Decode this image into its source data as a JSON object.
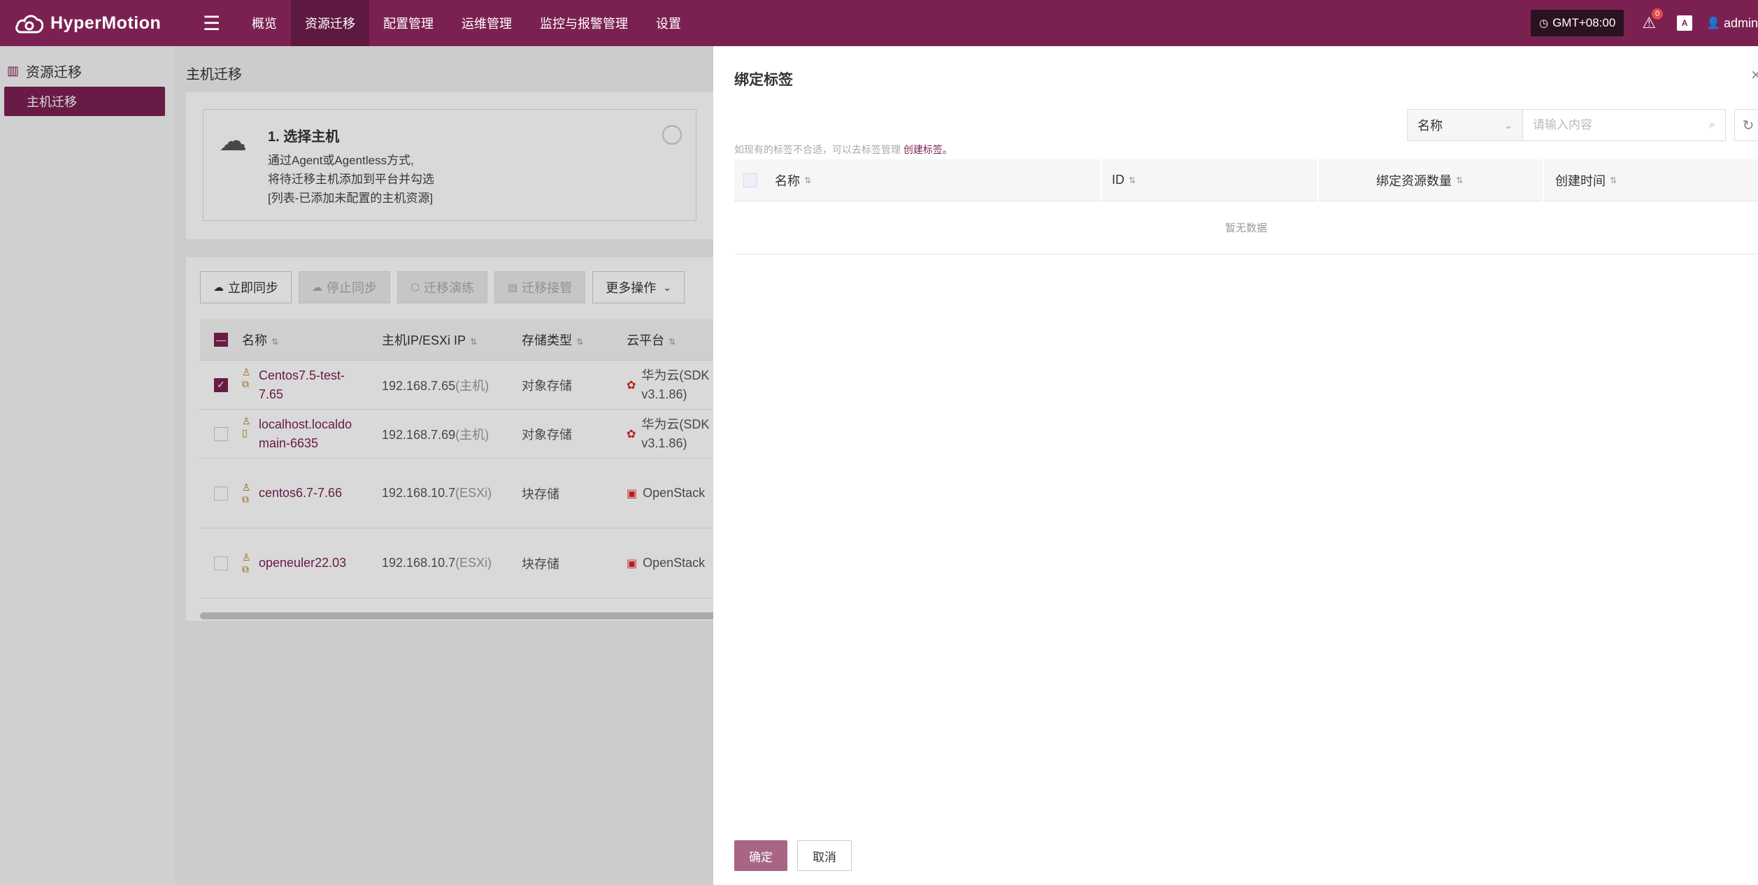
{
  "app": {
    "name": "HyperMotion"
  },
  "nav": {
    "items": [
      "概览",
      "资源迁移",
      "配置管理",
      "运维管理",
      "监控与报警管理",
      "设置"
    ],
    "active_index": 1
  },
  "topright": {
    "timezone": "GMT+08:00",
    "notifications": "0",
    "lang_icon": "A",
    "user": "admin"
  },
  "sidebar": {
    "title": "资源迁移",
    "items": [
      {
        "label": "主机迁移"
      }
    ]
  },
  "main": {
    "page_title": "主机迁移",
    "step": {
      "title": "1. 选择主机",
      "lines": [
        "通过Agent或Agentless方式,",
        "将待迁移主机添加到平台并勾选",
        "[列表-已添加未配置的主机资源]"
      ]
    },
    "toolbar": {
      "sync": "立即同步",
      "stop_sync": "停止同步",
      "drill": "迁移演练",
      "takeover": "迁移接管",
      "more": "更多操作"
    },
    "table": {
      "headers": [
        "名称",
        "主机IP/ESXi IP",
        "存储类型",
        "云平台"
      ],
      "rows": [
        {
          "name": "Centos7.5-test-7.65",
          "ip": "192.168.7.65",
          "ip_tag": "(主机)",
          "storage": "对象存储",
          "cloud": "华为云(SDK v3.1.86)",
          "checked": true
        },
        {
          "name": "localhost.localdomain-6635",
          "ip": "192.168.7.69",
          "ip_tag": "(主机)",
          "storage": "对象存储",
          "cloud": "华为云(SDK v3.1.86)",
          "checked": false
        },
        {
          "name": "centos6.7-7.66",
          "ip": "192.168.10.7",
          "ip_tag": "(ESXi)",
          "storage": "块存储",
          "cloud": "OpenStack",
          "checked": false
        },
        {
          "name": "openeuler22.03",
          "ip": "192.168.10.7",
          "ip_tag": "(ESXi)",
          "storage": "块存储",
          "cloud": "OpenStack",
          "checked": false
        }
      ]
    }
  },
  "drawer": {
    "title": "绑定标签",
    "filter": {
      "field": "名称",
      "placeholder": "请输入内容"
    },
    "hint": "如现有的标签不合适，可以去标签管理 ",
    "hint_link": "创建标签。",
    "headers": {
      "name": "名称",
      "id": "ID",
      "count": "绑定资源数量",
      "created": "创建时间"
    },
    "empty": "暂无数据",
    "ok": "确定",
    "cancel": "取消"
  },
  "colors": {
    "brand": "#7b2152",
    "brand_dark": "#5e1940",
    "ok_button": "#a86585"
  }
}
